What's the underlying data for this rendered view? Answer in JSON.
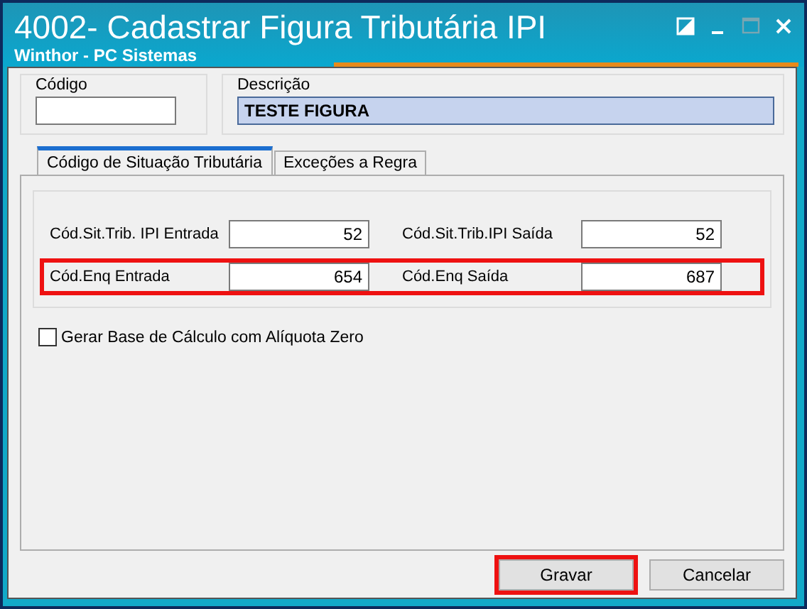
{
  "window": {
    "title": "4002- Cadastrar Figura Tributária IPI",
    "subtitle": "Winthor - PC Sistemas"
  },
  "header": {
    "code": {
      "label": "Código"
    },
    "description": {
      "label": "Descrição",
      "value": "TESTE FIGURA",
      "focused": true
    }
  },
  "tabs": [
    {
      "label": "Código de Situação Tributária",
      "selected": true
    },
    {
      "label": "Exceções a Regra",
      "selected": false
    }
  ],
  "fields": [
    {
      "highlighted": false,
      "items": [
        {
          "label": "Cód.Sit.Trib. IPI Entrada",
          "value": "52"
        },
        {
          "label": "Cód.Sit.Trib.IPI Saída",
          "value": "52"
        }
      ]
    },
    {
      "highlighted": true,
      "items": [
        {
          "label": "Cód.Enq Entrada",
          "value": "654"
        },
        {
          "label": "Cód.Enq Saída",
          "value": "687"
        }
      ]
    }
  ],
  "checkbox": {
    "label": "Gerar Base de Cálculo com Alíquota Zero",
    "checked": false
  },
  "buttons": [
    {
      "label": "Gravar",
      "highlighted": true
    },
    {
      "label": "Cancelar",
      "highlighted": false
    }
  ]
}
